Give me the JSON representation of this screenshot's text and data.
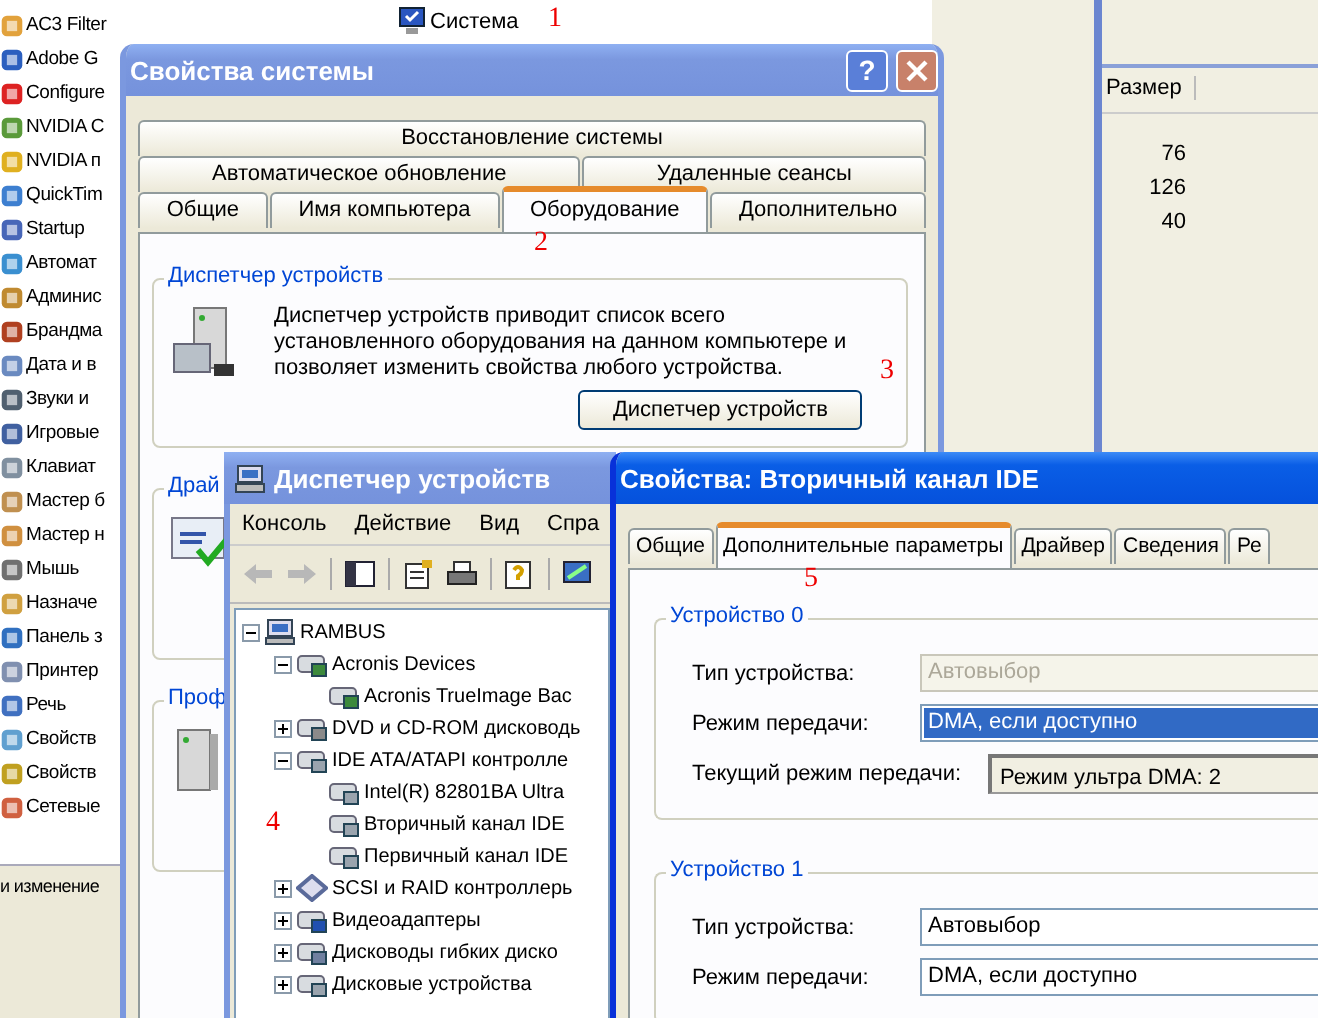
{
  "desktop_list": {
    "items": [
      {
        "label": "AC3 Filter"
      },
      {
        "label": "Adobe G"
      },
      {
        "label": "Configure"
      },
      {
        "label": "NVIDIA C"
      },
      {
        "label": "NVIDIA п"
      },
      {
        "label": "QuickTim"
      },
      {
        "label": "Startup"
      },
      {
        "label": "Автомат"
      },
      {
        "label": "Админис"
      },
      {
        "label": "Брандма"
      },
      {
        "label": "Дата и в"
      },
      {
        "label": "Звуки и"
      },
      {
        "label": "Игровые"
      },
      {
        "label": "Клавиат"
      },
      {
        "label": "Мастер б"
      },
      {
        "label": "Мастер н"
      },
      {
        "label": "Мышь"
      },
      {
        "label": "Назначе"
      },
      {
        "label": "Панель з"
      },
      {
        "label": "Принтер"
      },
      {
        "label": "Речь"
      },
      {
        "label": "Свойств"
      },
      {
        "label": "Свойств"
      },
      {
        "label": "Сетевые"
      }
    ]
  },
  "system_item": {
    "label": "Система"
  },
  "status_text": "и изменение",
  "right_window": {
    "column": "Размер",
    "rows": [
      "76",
      "126",
      "40"
    ]
  },
  "system_properties": {
    "title": "Свойства системы",
    "help_button": "?",
    "tab_rows": [
      {
        "tabs": [
          {
            "label": "Восстановление системы",
            "selected": false
          }
        ]
      },
      {
        "tabs": [
          {
            "label": "Автоматическое обновление",
            "selected": false
          },
          {
            "label": "Удаленные сеансы",
            "selected": false
          }
        ]
      },
      {
        "tabs": [
          {
            "label": "Общие",
            "selected": false
          },
          {
            "label": "Имя компьютера",
            "selected": false
          },
          {
            "label": "Оборудование",
            "selected": true
          },
          {
            "label": "Дополнительно",
            "selected": false
          }
        ]
      }
    ],
    "device_group": {
      "title": "Диспетчер устройств",
      "text": "Диспетчер устройств приводит список всего установленного оборудования на данном компьютере и позволяет изменить свойства любого устройства.",
      "button": "Диспетчер устройств"
    },
    "other_groups": [
      {
        "title": "Драй"
      },
      {
        "title": "Проф"
      }
    ]
  },
  "device_manager": {
    "title": "Диспетчер устройств",
    "menu": [
      "Консоль",
      "Действие",
      "Вид",
      "Спра"
    ],
    "tree": {
      "label": "RAMBUS",
      "kind": "computer",
      "expanded": true,
      "children": [
        {
          "label": "Acronis Devices",
          "kind": "card",
          "expanded": true,
          "children": [
            {
              "label": "Acronis TrueImage Bac",
              "kind": "card"
            }
          ]
        },
        {
          "label": "DVD и CD-ROM дисководь",
          "kind": "disc",
          "expanded": false
        },
        {
          "label": "IDE ATA/ATAPI контролле",
          "kind": "controller",
          "expanded": true,
          "children": [
            {
              "label": "Intel(R) 82801BA Ultra",
              "kind": "controller"
            },
            {
              "label": "Вторичный канал IDE",
              "kind": "controller"
            },
            {
              "label": "Первичный канал IDE",
              "kind": "controller"
            }
          ]
        },
        {
          "label": "SCSI и RAID контроллерь",
          "kind": "scsi",
          "expanded": false
        },
        {
          "label": "Видеоадаптеры",
          "kind": "display",
          "expanded": false
        },
        {
          "label": "Дисководы гибких диско",
          "kind": "floppy",
          "expanded": false
        },
        {
          "label": "Дисковые устройства",
          "kind": "controller",
          "expanded": false
        }
      ]
    }
  },
  "ide_properties": {
    "title": "Свойства: Вторичный канал IDE",
    "tabs": [
      {
        "label": "Общие",
        "selected": false
      },
      {
        "label": "Дополнительные параметры",
        "selected": true
      },
      {
        "label": "Драйвер",
        "selected": false
      },
      {
        "label": "Сведения",
        "selected": false
      },
      {
        "label": "Ре",
        "selected": false
      }
    ],
    "devices": [
      {
        "title": "Устройство 0",
        "fields": [
          {
            "label": "Тип устройства:",
            "kind": "combo",
            "value": "Автовыбор",
            "disabled": true,
            "selected": false
          },
          {
            "label": "Режим передачи:",
            "kind": "combo",
            "value": "DMA, если доступно",
            "disabled": false,
            "selected": true
          },
          {
            "label": "Текущий режим передачи:",
            "kind": "readout",
            "value": "Режим ультра DMA: 2"
          }
        ]
      },
      {
        "title": "Устройство 1",
        "fields": [
          {
            "label": "Тип устройства:",
            "kind": "combo",
            "value": "Автовыбор",
            "disabled": false,
            "selected": false
          },
          {
            "label": "Режим передачи:",
            "kind": "combo",
            "value": "DMA, если доступно",
            "disabled": false,
            "selected": false
          }
        ]
      }
    ]
  },
  "markers": [
    {
      "label": "1"
    },
    {
      "label": "2"
    },
    {
      "label": "3"
    },
    {
      "label": "4"
    },
    {
      "label": "5"
    }
  ]
}
